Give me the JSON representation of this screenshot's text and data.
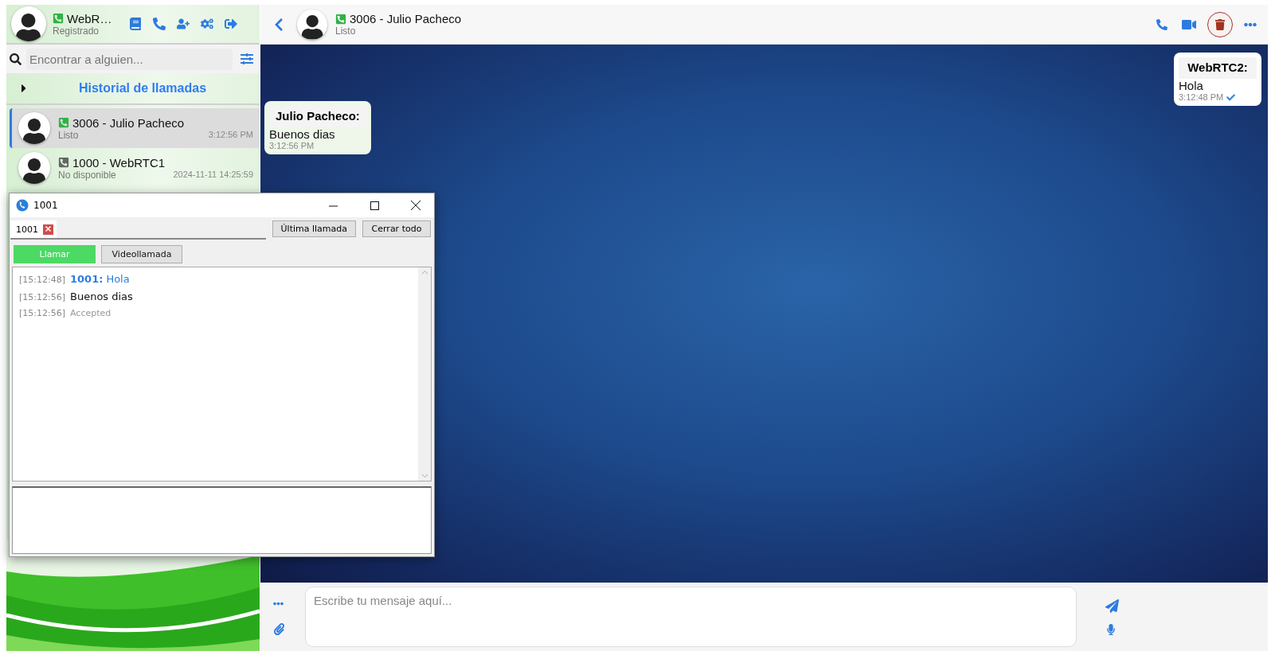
{
  "account": {
    "name": "WebR…",
    "status": "Registrado",
    "available": true
  },
  "search": {
    "placeholder": "Encontrar a alguien..."
  },
  "history": {
    "title": "Historial de llamadas",
    "expanded": false
  },
  "contacts": [
    {
      "name": "3006 - Julio Pacheco",
      "status": "Listo",
      "time": "3:12:56 PM",
      "available": true,
      "selected": true
    },
    {
      "name": "1000 - WebRTC1",
      "status": "No disponible",
      "time": "2024-11-11 14:25:59",
      "available": false,
      "selected": false
    }
  ],
  "chat": {
    "title": "3006 - Julio Pacheco",
    "status": "Listo",
    "available": true
  },
  "messages": [
    {
      "kind": "outgoing",
      "sender": "WebRTC2:",
      "text": "Hola",
      "time": "3:12:48 PM",
      "delivered": true
    },
    {
      "kind": "incoming",
      "sender": "Julio Pacheco:",
      "text": "Buenos dias",
      "time": "3:12:56 PM",
      "delivered": false
    }
  ],
  "composer": {
    "placeholder": "Escribe tu mensaje aquí..."
  },
  "popup": {
    "title": "1001",
    "tabs": [
      {
        "label": "1001",
        "selected": true
      }
    ],
    "buttons": [
      "Última llamada",
      "Cerrar todo"
    ],
    "actions": [
      {
        "label": "Llamar",
        "selected": true
      },
      {
        "label": "Videollamada",
        "selected": false
      }
    ],
    "log": [
      {
        "time": "[15:12:48]",
        "kind": "remote",
        "sender": "1001:",
        "text": "Hola"
      },
      {
        "time": "[15:12:56]",
        "kind": "local",
        "text": "Buenos dias"
      },
      {
        "time": "[15:12:56]",
        "kind": "event",
        "text": "Accepted"
      }
    ]
  }
}
